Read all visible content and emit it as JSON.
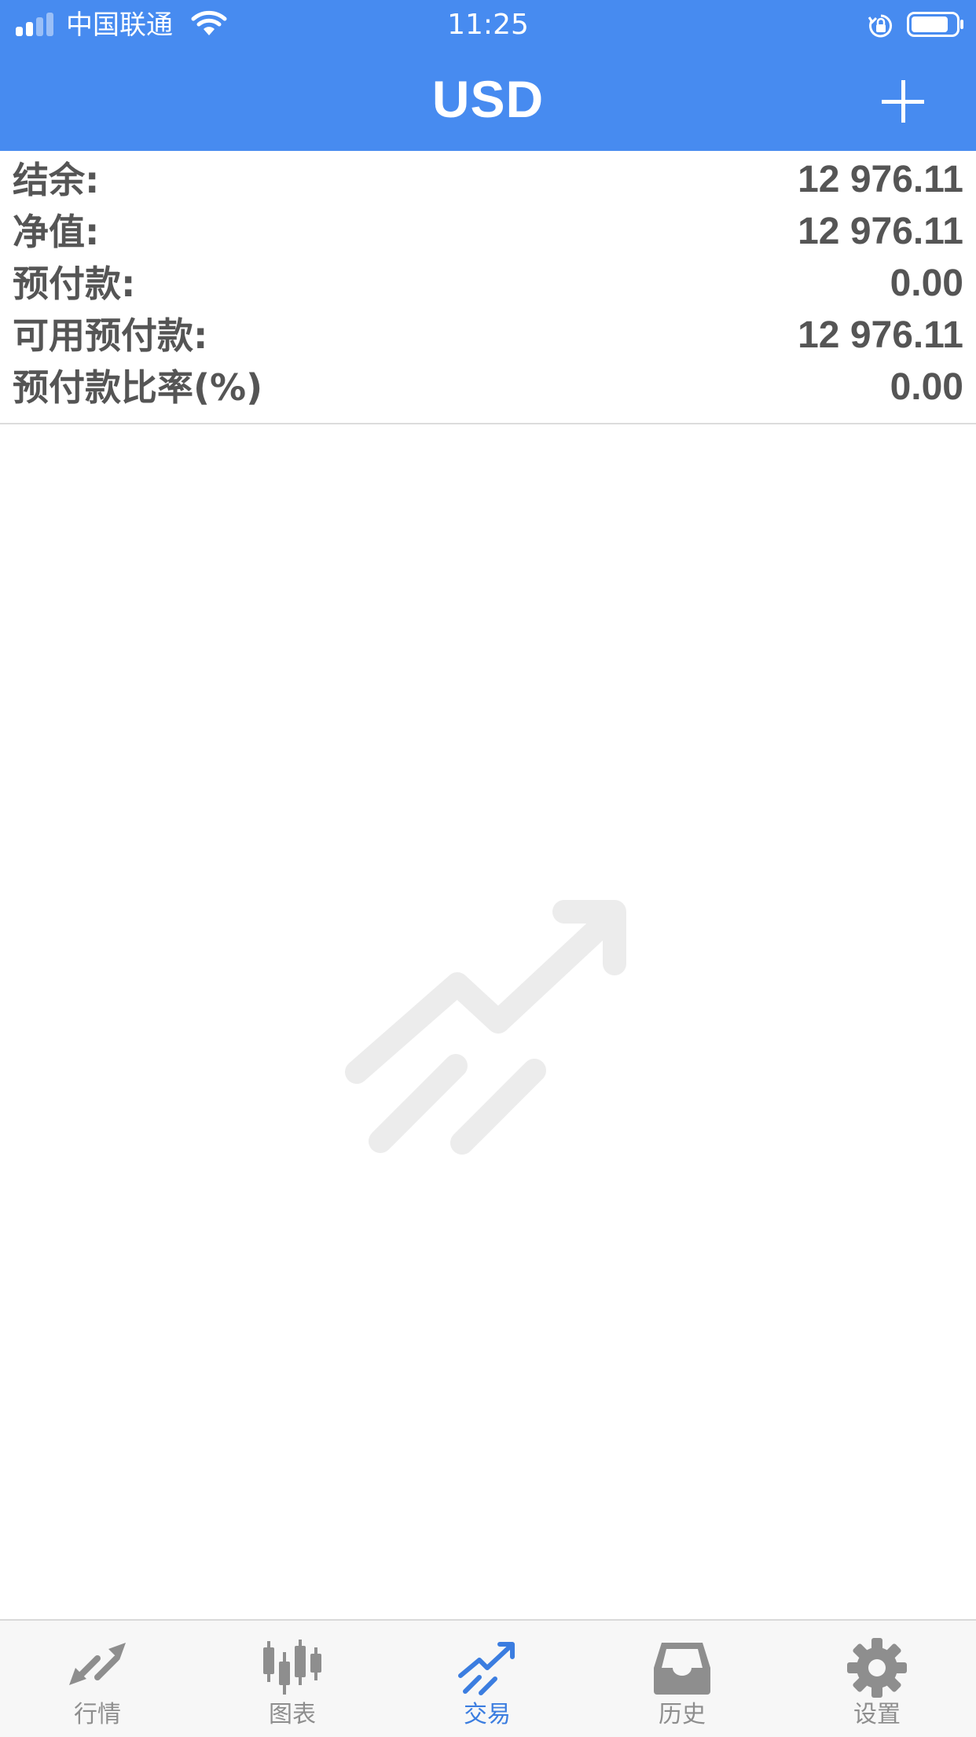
{
  "status_bar": {
    "carrier": "中国联通",
    "time": "11:25"
  },
  "header": {
    "title": "USD",
    "add_icon": "plus-icon"
  },
  "summary": [
    {
      "label": "结余:",
      "value": "12 976.11"
    },
    {
      "label": "净值:",
      "value": "12 976.11"
    },
    {
      "label": "预付款:",
      "value": "0.00"
    },
    {
      "label": "可用预付款:",
      "value": "12 976.11"
    },
    {
      "label": "预付款比率(%)",
      "value": "0.00"
    }
  ],
  "tabs": [
    {
      "label": "行情",
      "icon": "quotes-arrows-icon",
      "active": false
    },
    {
      "label": "图表",
      "icon": "candlestick-chart-icon",
      "active": false
    },
    {
      "label": "交易",
      "icon": "trade-trend-icon",
      "active": true
    },
    {
      "label": "历史",
      "icon": "history-tray-icon",
      "active": false
    },
    {
      "label": "设置",
      "icon": "gear-icon",
      "active": false
    }
  ],
  "colors": {
    "header_bg": "#478bf0",
    "active_tab": "#3b7de0",
    "inactive_tab": "#8e8e8e",
    "text": "#555555"
  }
}
